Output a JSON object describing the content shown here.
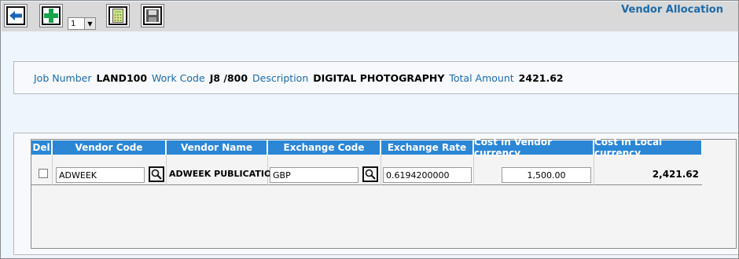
{
  "window": {
    "title": "Vendor Allocation"
  },
  "toolbar": {
    "pager_value": "1",
    "buttons": [
      "back-icon",
      "add-icon",
      "calculator-icon",
      "save-icon"
    ]
  },
  "job": {
    "job_number_label": "Job Number",
    "job_number": "LAND100",
    "work_code_label": "Work Code",
    "work_code": "J8 /800",
    "description_label": "Description",
    "description": "DIGITAL PHOTOGRAPHY",
    "total_amount_label": "Total Amount",
    "total_amount": "2421.62"
  },
  "grid": {
    "columns": [
      "Del",
      "Vendor Code",
      "Vendor Name",
      "Exchange Code",
      "Exchange Rate",
      "Cost in Vendor currency",
      "Cost in Local currency"
    ],
    "rows": [
      {
        "vendor_code": "ADWEEK",
        "vendor_name": "ADWEEK PUBLICATION",
        "exchange_code": "GBP",
        "exchange_rate": "0.6194200000",
        "cost_vendor": "1,500.00",
        "cost_local": "2,421.62"
      }
    ]
  },
  "colors": {
    "header_blue": "#2b86d6",
    "label_blue": "#1c6aa8",
    "toolbar_gray": "#d9d9d9"
  }
}
